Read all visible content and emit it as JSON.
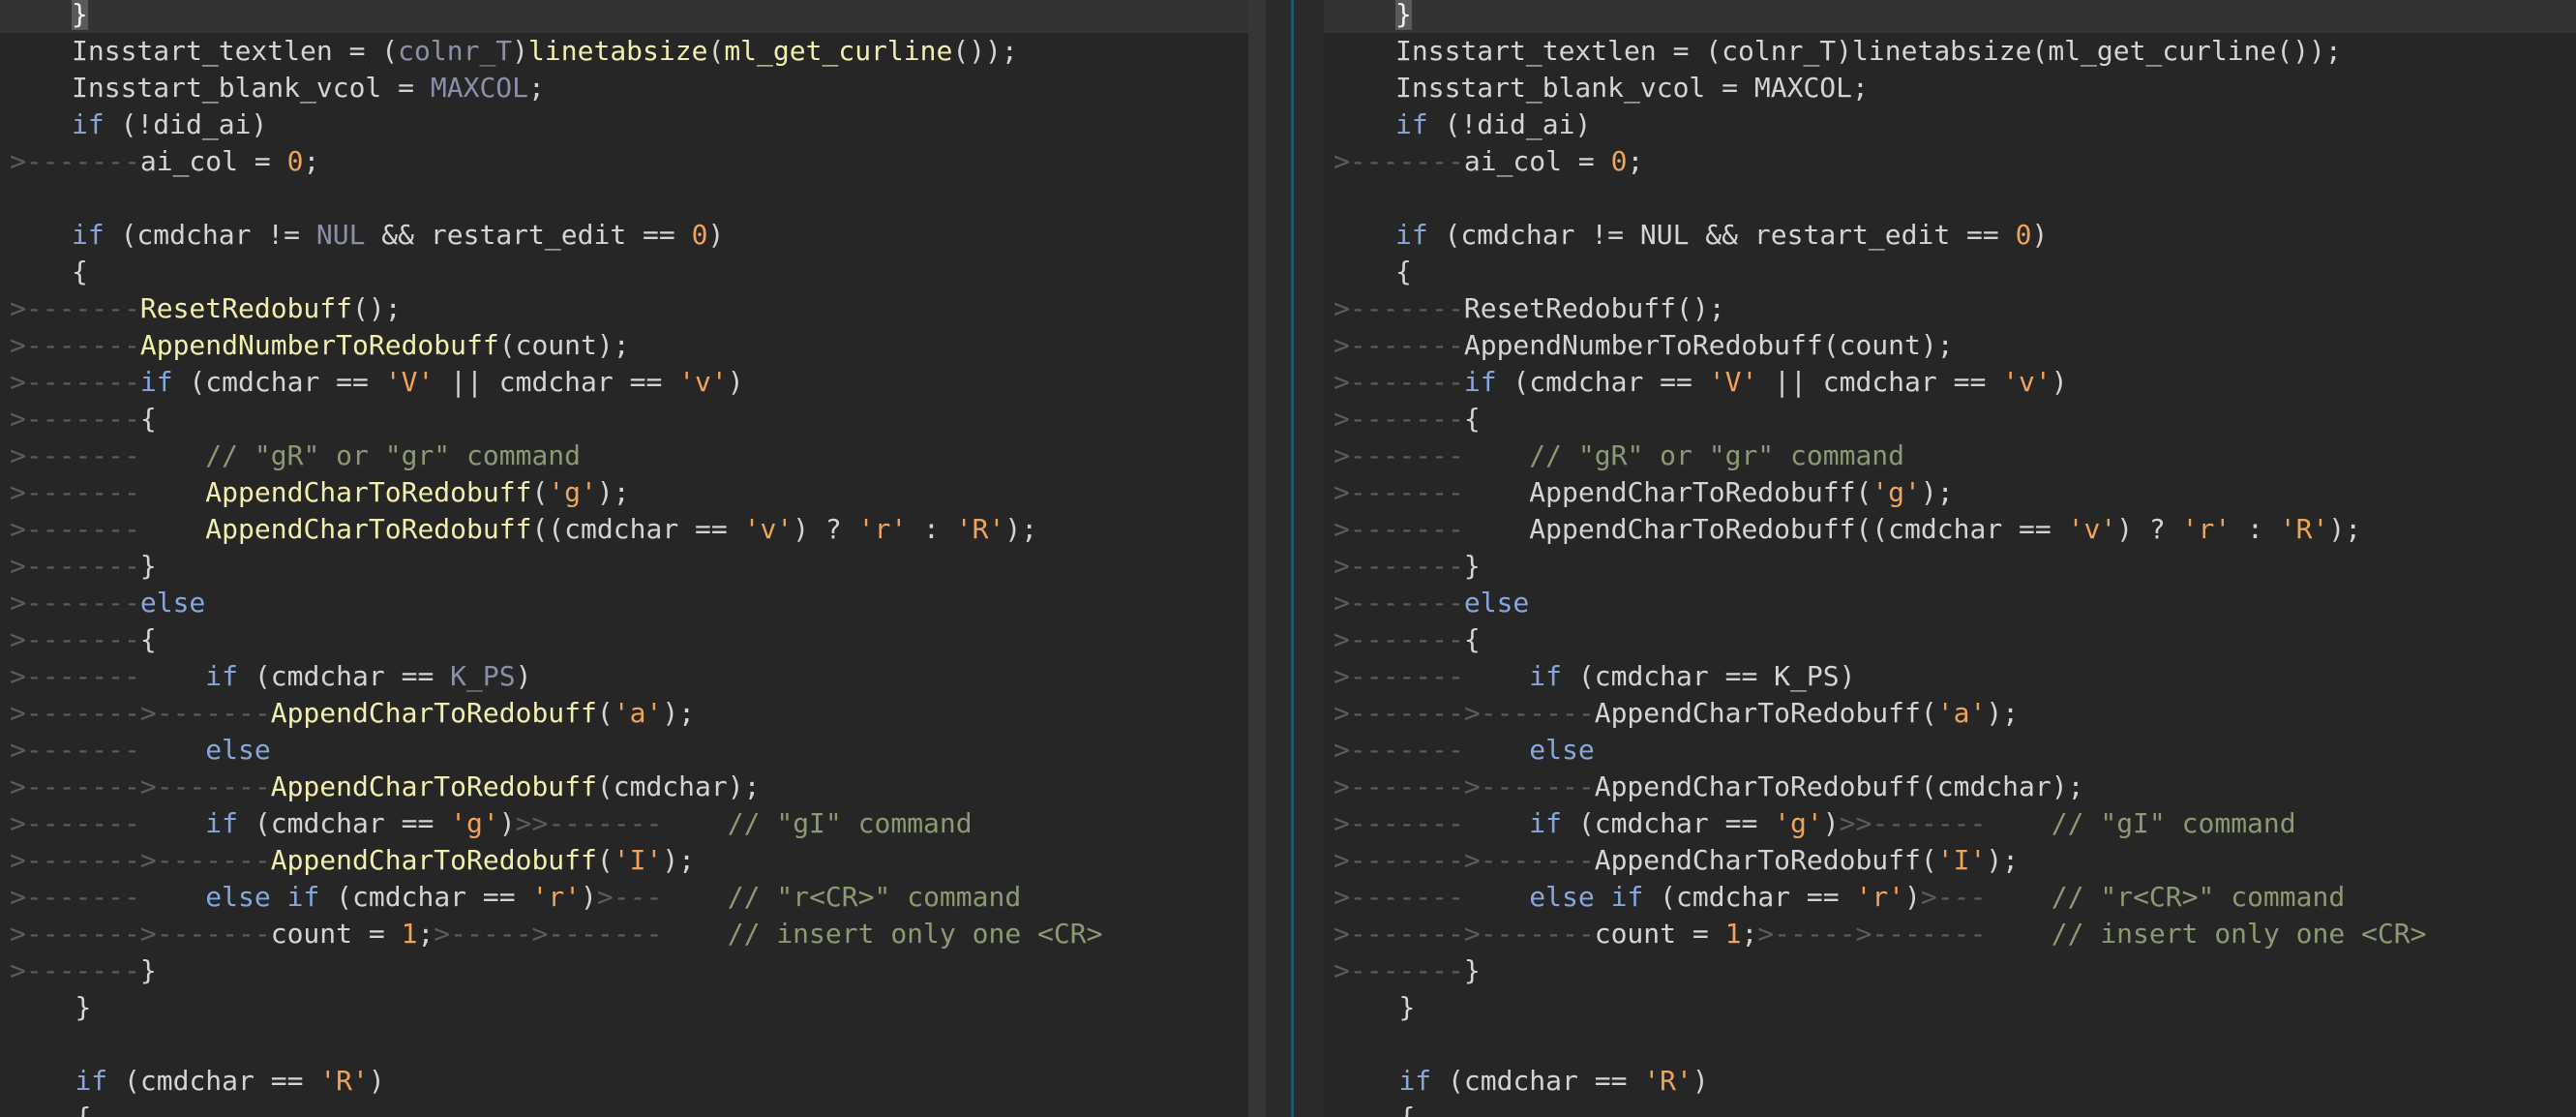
{
  "colors": {
    "background": "#262626",
    "current_line": "#333333",
    "keyword": "#86a7dc",
    "function": "#f1eeae",
    "string_number": "#f0a35a",
    "comment": "#8b9a72",
    "constant": "#8c8fa8",
    "whitespace": "#5c5c5c",
    "split_marker": "#1f5c6b"
  },
  "lines": [
    [
      [
        "cursor",
        "}"
      ]
    ],
    [
      [
        "pl",
        "Insstart_textlen = ("
      ],
      [
        "cst",
        "colnr_T"
      ],
      [
        "pl",
        ")"
      ],
      [
        "fn",
        "linetabsize"
      ],
      [
        "pl",
        "("
      ],
      [
        "fn",
        "ml_get_curline"
      ],
      [
        "pl",
        "());"
      ]
    ],
    [
      [
        "pl",
        "Insstart_blank_vcol = "
      ],
      [
        "cst",
        "MAXCOL"
      ],
      [
        "pl",
        ";"
      ]
    ],
    [
      [
        "kw",
        "if"
      ],
      [
        "pl",
        " (!did_ai)"
      ]
    ],
    [
      [
        "tab",
        ">-------"
      ],
      [
        "pl",
        "ai_col = "
      ],
      [
        "num",
        "0"
      ],
      [
        "pl",
        ";"
      ]
    ],
    [],
    [
      [
        "kw",
        "if"
      ],
      [
        "pl",
        " (cmdchar != "
      ],
      [
        "cst",
        "NUL"
      ],
      [
        "pl",
        " && restart_edit == "
      ],
      [
        "num",
        "0"
      ],
      [
        "pl",
        ")"
      ]
    ],
    [
      [
        "pl",
        "{"
      ]
    ],
    [
      [
        "tab",
        ">-------"
      ],
      [
        "fn",
        "ResetRedobuff"
      ],
      [
        "pl",
        "();"
      ]
    ],
    [
      [
        "tab",
        ">-------"
      ],
      [
        "fn",
        "AppendNumberToRedobuff"
      ],
      [
        "pl",
        "(count);"
      ]
    ],
    [
      [
        "tab",
        ">-------"
      ],
      [
        "kw",
        "if"
      ],
      [
        "pl",
        " (cmdchar == "
      ],
      [
        "str",
        "'V'"
      ],
      [
        "pl",
        " || cmdchar == "
      ],
      [
        "str",
        "'v'"
      ],
      [
        "pl",
        ")"
      ]
    ],
    [
      [
        "tab",
        ">-------"
      ],
      [
        "pl",
        "{"
      ]
    ],
    [
      [
        "tab",
        ">-------"
      ],
      [
        "sp",
        "    "
      ],
      [
        "cmt",
        "// \"gR\" or \"gr\" command"
      ]
    ],
    [
      [
        "tab",
        ">-------"
      ],
      [
        "sp",
        "    "
      ],
      [
        "fn",
        "AppendCharToRedobuff"
      ],
      [
        "pl",
        "("
      ],
      [
        "str",
        "'g'"
      ],
      [
        "pl",
        ");"
      ]
    ],
    [
      [
        "tab",
        ">-------"
      ],
      [
        "sp",
        "    "
      ],
      [
        "fn",
        "AppendCharToRedobuff"
      ],
      [
        "pl",
        "((cmdchar == "
      ],
      [
        "str",
        "'v'"
      ],
      [
        "pl",
        ") ? "
      ],
      [
        "str",
        "'r'"
      ],
      [
        "pl",
        " : "
      ],
      [
        "str",
        "'R'"
      ],
      [
        "pl",
        ");"
      ]
    ],
    [
      [
        "tab",
        ">-------"
      ],
      [
        "pl",
        "}"
      ]
    ],
    [
      [
        "tab",
        ">-------"
      ],
      [
        "kw",
        "else"
      ]
    ],
    [
      [
        "tab",
        ">-------"
      ],
      [
        "pl",
        "{"
      ]
    ],
    [
      [
        "tab",
        ">-------"
      ],
      [
        "sp",
        "    "
      ],
      [
        "kw",
        "if"
      ],
      [
        "pl",
        " (cmdchar == "
      ],
      [
        "cst",
        "K_PS"
      ],
      [
        "pl",
        ")"
      ]
    ],
    [
      [
        "tab",
        ">------->-------"
      ],
      [
        "fn",
        "AppendCharToRedobuff"
      ],
      [
        "pl",
        "("
      ],
      [
        "str",
        "'a'"
      ],
      [
        "pl",
        ");"
      ]
    ],
    [
      [
        "tab",
        ">-------"
      ],
      [
        "sp",
        "    "
      ],
      [
        "kw",
        "else"
      ]
    ],
    [
      [
        "tab",
        ">------->-------"
      ],
      [
        "fn",
        "AppendCharToRedobuff"
      ],
      [
        "pl",
        "(cmdchar);"
      ]
    ],
    [
      [
        "tab",
        ">-------"
      ],
      [
        "sp",
        "    "
      ],
      [
        "kw",
        "if"
      ],
      [
        "pl",
        " (cmdchar == "
      ],
      [
        "str",
        "'g'"
      ],
      [
        "pl",
        ")"
      ],
      [
        "tab",
        ">>-------"
      ],
      [
        "sp",
        "    "
      ],
      [
        "cmt",
        "// \"gI\" command"
      ]
    ],
    [
      [
        "tab",
        ">------->-------"
      ],
      [
        "fn",
        "AppendCharToRedobuff"
      ],
      [
        "pl",
        "("
      ],
      [
        "str",
        "'I'"
      ],
      [
        "pl",
        ");"
      ]
    ],
    [
      [
        "tab",
        ">-------"
      ],
      [
        "sp",
        "    "
      ],
      [
        "kw",
        "else if"
      ],
      [
        "pl",
        " (cmdchar == "
      ],
      [
        "str",
        "'r'"
      ],
      [
        "pl",
        ")"
      ],
      [
        "tab",
        ">---"
      ],
      [
        "sp",
        "    "
      ],
      [
        "cmt",
        "// \"r<CR>\" command"
      ]
    ],
    [
      [
        "tab",
        ">------->-------"
      ],
      [
        "pl",
        "count = "
      ],
      [
        "num",
        "1"
      ],
      [
        "pl",
        ";"
      ],
      [
        "tab",
        ">----->-------"
      ],
      [
        "sp",
        "    "
      ],
      [
        "cmt",
        "// insert only one <CR>"
      ]
    ],
    [
      [
        "tab",
        ">-------"
      ],
      [
        "pl",
        "}"
      ]
    ],
    [
      [
        "sp",
        "    "
      ],
      [
        "pl",
        "}"
      ]
    ],
    [],
    [
      [
        "sp",
        "    "
      ],
      [
        "kw",
        "if"
      ],
      [
        "pl",
        " (cmdchar == "
      ],
      [
        "str",
        "'R'"
      ],
      [
        "pl",
        ")"
      ]
    ],
    [
      [
        "sp",
        "    "
      ],
      [
        "pl",
        "{"
      ]
    ]
  ]
}
